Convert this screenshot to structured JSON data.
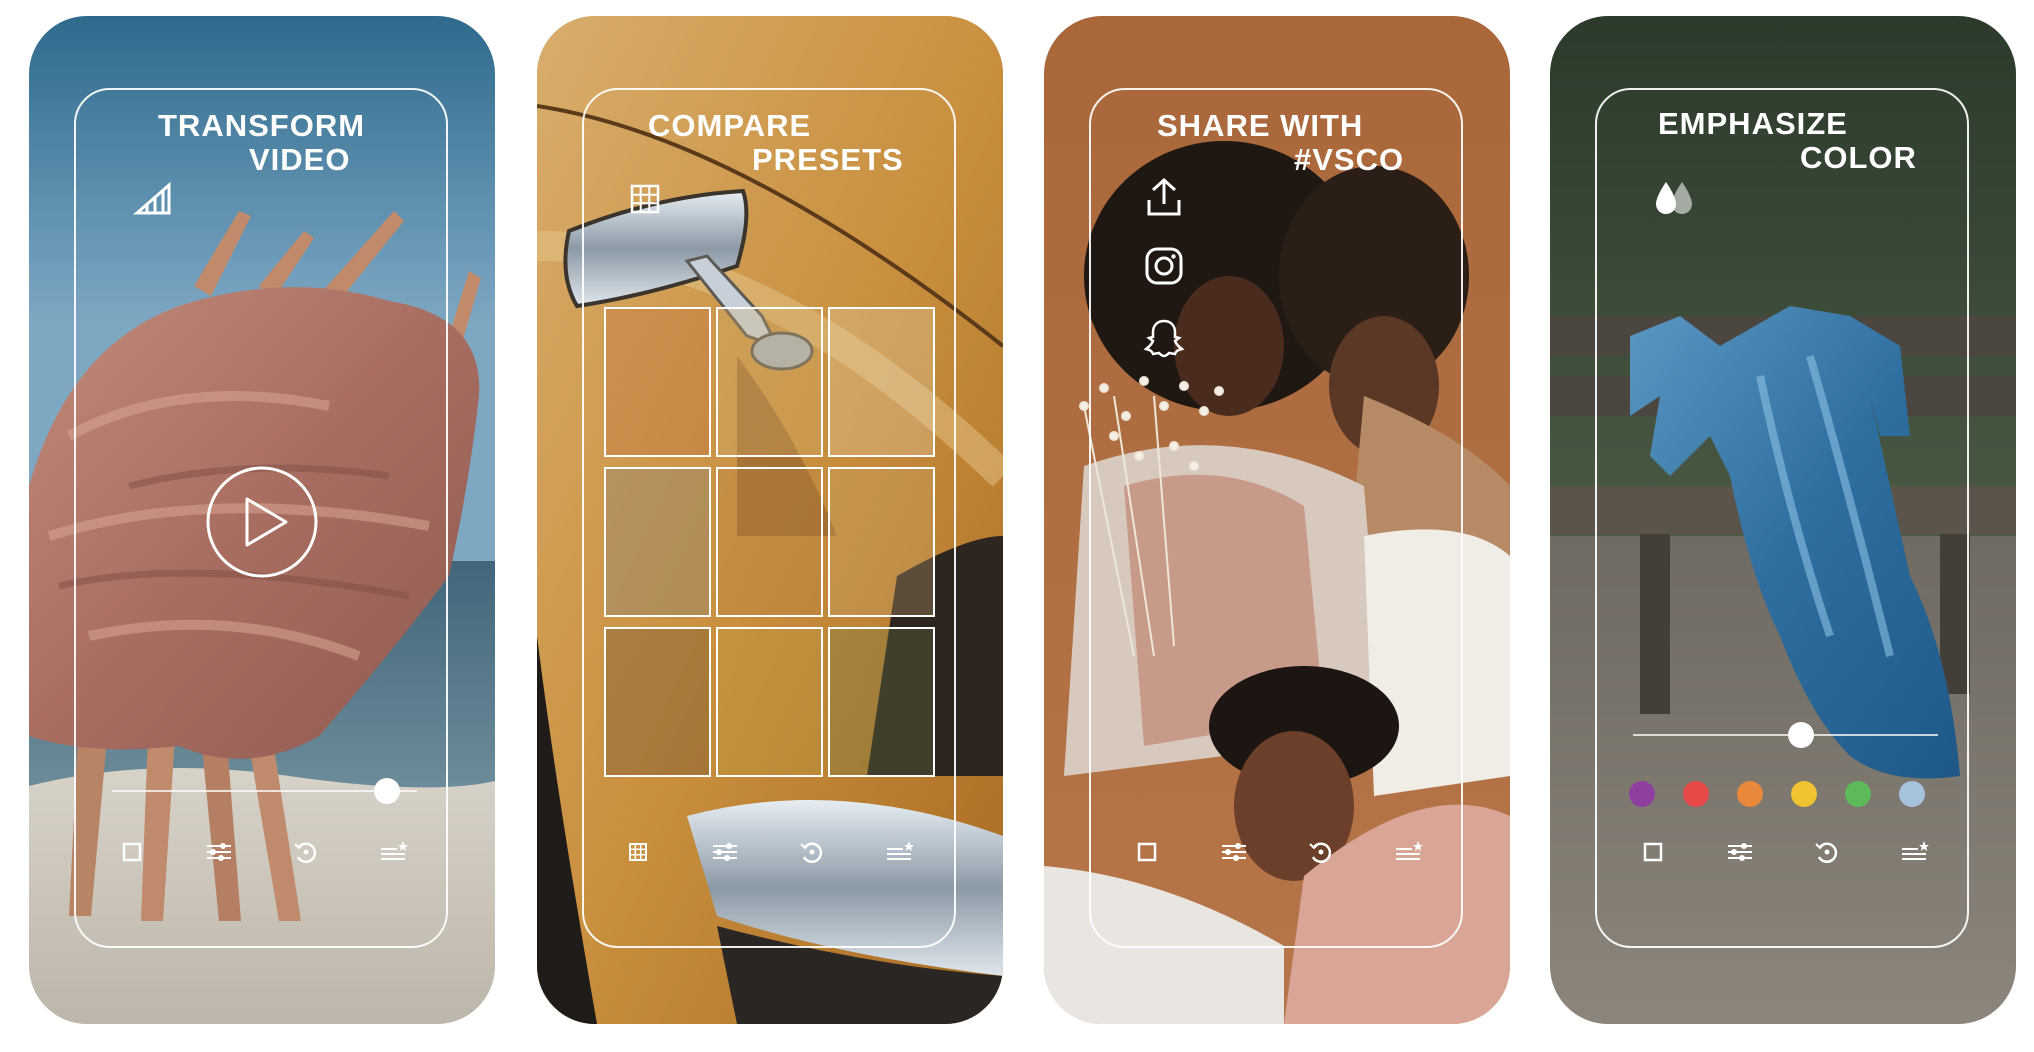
{
  "screens": [
    {
      "headline_line1": "TRANSFORM",
      "headline_line2": "VIDEO",
      "icons": [
        "signal-bars-icon",
        "play-icon"
      ],
      "slider_level": 0.9
    },
    {
      "headline_line1": "COMPARE",
      "headline_line2": "PRESETS",
      "icons": [
        "grid-icon"
      ]
    },
    {
      "headline_line1": "SHARE WITH",
      "headline_line2": "#VSCO",
      "icons": [
        "upload-icon",
        "instagram-icon",
        "snapchat-icon"
      ]
    },
    {
      "headline_line1": "EMPHASIZE",
      "headline_line2": "COLOR",
      "icons": [
        "droplets-icon"
      ],
      "slider_level": 0.55,
      "color_swatches": [
        "#8e3fa0",
        "#e84a4a",
        "#e9873a",
        "#f1c232",
        "#5cba5a",
        "#a6c2dc"
      ]
    }
  ],
  "toolbar": [
    "square-icon",
    "sliders-icon",
    "history-icon",
    "presets-icon"
  ]
}
